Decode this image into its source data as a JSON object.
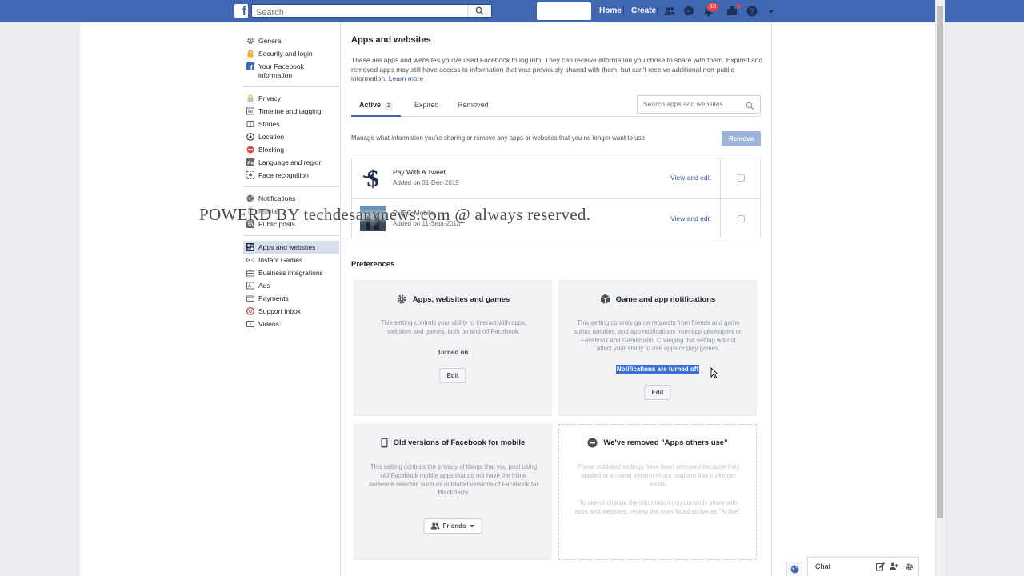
{
  "topbar": {
    "search_placeholder": "Search",
    "nav_home": "Home",
    "nav_create": "Create",
    "notifications_count": "10",
    "brand_color": "#4267b2"
  },
  "sidebar": {
    "groups": [
      [
        {
          "label": "General",
          "icon": "gear-icon"
        },
        {
          "label": "Security and login",
          "icon": "lock-icon"
        },
        {
          "label": "Your Facebook information",
          "icon": "facebook-icon"
        }
      ],
      [
        {
          "label": "Privacy",
          "icon": "privacy-lock-icon"
        },
        {
          "label": "Timeline and tagging",
          "icon": "timeline-icon"
        },
        {
          "label": "Stories",
          "icon": "book-icon"
        },
        {
          "label": "Location",
          "icon": "location-icon"
        },
        {
          "label": "Blocking",
          "icon": "block-icon"
        },
        {
          "label": "Language and region",
          "icon": "language-icon"
        },
        {
          "label": "Face recognition",
          "icon": "face-icon"
        }
      ],
      [
        {
          "label": "Notifications",
          "icon": "globe-icon"
        },
        {
          "label": "Mobile",
          "icon": "mobile-icon"
        },
        {
          "label": "Public posts",
          "icon": "rss-icon"
        }
      ],
      [
        {
          "label": "Apps and websites",
          "icon": "apps-icon",
          "active": true
        },
        {
          "label": "Instant Games",
          "icon": "gamepad-icon"
        },
        {
          "label": "Business integrations",
          "icon": "business-icon"
        },
        {
          "label": "Ads",
          "icon": "ads-icon"
        },
        {
          "label": "Payments",
          "icon": "card-icon"
        },
        {
          "label": "Support Inbox",
          "icon": "lifebuoy-icon"
        },
        {
          "label": "Videos",
          "icon": "video-icon"
        }
      ]
    ]
  },
  "main": {
    "title": "Apps and websites",
    "intro": "These are apps and websites you've used Facebook to log into. They can receive information you chose to share with them. Expired and removed apps may still have access to information that was previously shared with them, but can't receive additional non-public information.",
    "learn_more": "Learn more",
    "tabs": [
      {
        "label": "Active",
        "count": "2"
      },
      {
        "label": "Expired"
      },
      {
        "label": "Removed"
      }
    ],
    "search_placeholder": "Search apps and websites",
    "manage_text": "Manage what information you're sharing or remove any apps or websites that you no longer want to use.",
    "remove_label": "Remove",
    "apps": [
      {
        "name": "Pay With A Tweet",
        "date": "Added on 31-Dec-2019",
        "action": "View and edit"
      },
      {
        "name": "PUBG Mobile",
        "date": "Added on 11-Sept-2018",
        "action": "View and edit"
      }
    ]
  },
  "preferences": {
    "heading": "Preferences",
    "cards": [
      {
        "title": "Apps, websites and games",
        "icon": "gear-icon",
        "desc": "This setting controls your ability to interact with apps, websites and games, both on and off Facebook.",
        "status": "Turned on",
        "button": "Edit"
      },
      {
        "title": "Game and app notifications",
        "icon": "cube-icon",
        "desc": "This setting controls game requests from friends and game status updates, and app notifications from app developers on Facebook and Gameroom. Changing this setting will not affect your ability to use apps or play games.",
        "status": "Notifications are turned off",
        "button": "Edit"
      },
      {
        "title": "Old versions of Facebook for mobile",
        "icon": "mobile-icon",
        "desc": "This setting controls the privacy of things that you post using old Facebook mobile apps that do not have the inline audience selector, such as outdated versions of Facebook for BlackBerry.",
        "button": "Friends"
      },
      {
        "title": "We've removed \"Apps others use\"",
        "icon": "minus-circle-icon",
        "desc": "These outdated settings have been removed because they applied to an older version of our platform that no longer exists.",
        "desc2": "To see or change the information you currently share with apps and websites, review the ones listed above as \"Active\"."
      }
    ]
  },
  "watermark": "POWERD BY techdesanynews.com @ always reserved.",
  "chat": {
    "label": "Chat"
  }
}
